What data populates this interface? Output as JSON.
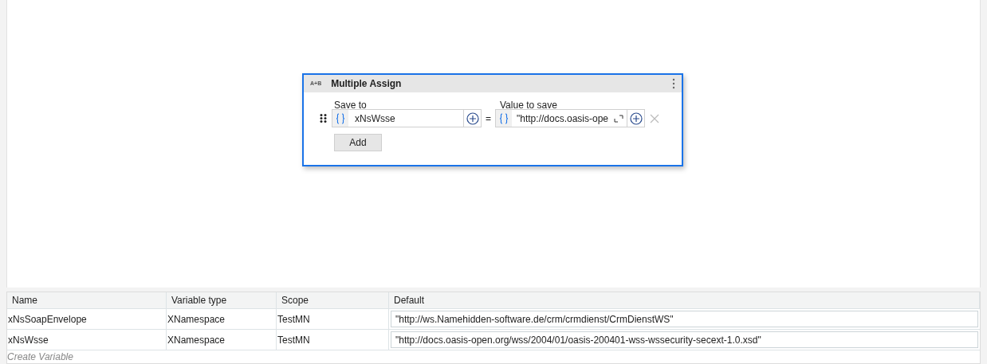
{
  "activity": {
    "badge": "A+B",
    "title": "Multiple Assign",
    "save_to_label": "Save to",
    "value_label": "Value to save",
    "assignments": [
      {
        "save_to": "xNsWsse",
        "operator": "=",
        "value": "\"http://docs.oasis-ope"
      }
    ],
    "add_button": "Add"
  },
  "variables": {
    "columns": [
      "Name",
      "Variable type",
      "Scope",
      "Default"
    ],
    "rows": [
      {
        "name": "xNsSoapEnvelope",
        "type": "XNamespace",
        "scope": "TestMN",
        "default": "\"http://ws.Namehidden-software.de/crm/crmdienst/CrmDienstWS\""
      },
      {
        "name": "xNsWsse",
        "type": "XNamespace",
        "scope": "TestMN",
        "default": "\"http://docs.oasis-open.org/wss/2004/01/oasis-200401-wss-wssecurity-secext-1.0.xsd\""
      }
    ],
    "create_placeholder": "Create Variable"
  }
}
